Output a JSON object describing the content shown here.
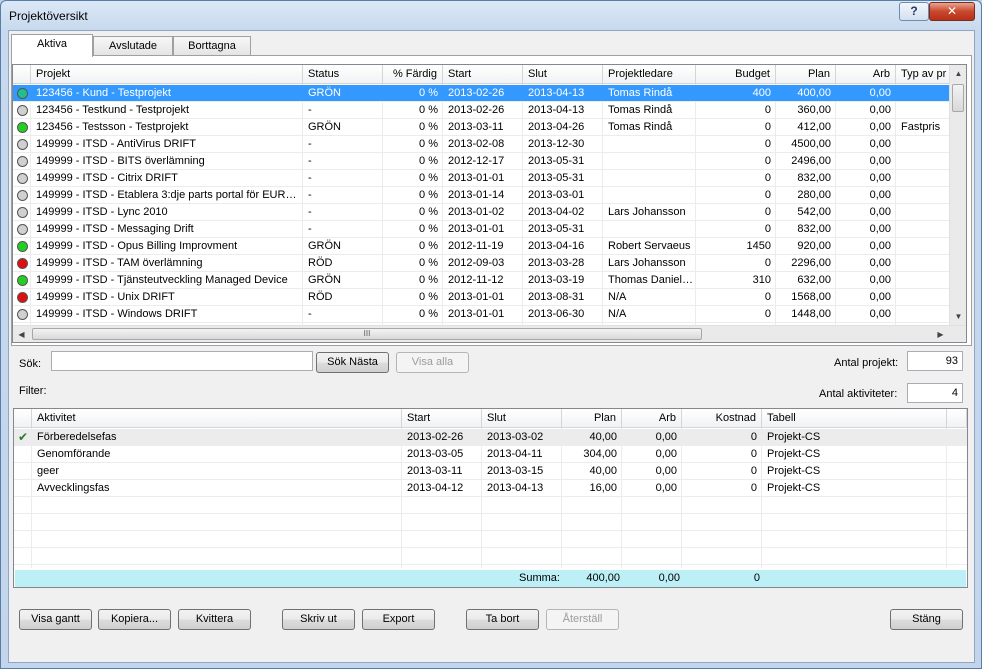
{
  "window": {
    "title": "Projektöversikt",
    "help_label": "?",
    "close_label": "✕"
  },
  "tabs": [
    {
      "label": "Aktiva",
      "active": true
    },
    {
      "label": "Avslutade",
      "active": false
    },
    {
      "label": "Borttagna",
      "active": false
    }
  ],
  "project_grid": {
    "headers": [
      "Projekt",
      "Status",
      "% Färdig",
      "Start",
      "Slut",
      "Projektledare",
      "Budget",
      "Plan",
      "Arb",
      "Typ av pr"
    ],
    "rows": [
      {
        "status_color": "#1fbf8f",
        "projekt": "123456 - Kund - Testprojekt",
        "status": "GRÖN",
        "pct": "0 %",
        "start": "2013-02-26",
        "slut": "2013-04-13",
        "ledare": "Tomas Rindå",
        "budget": "400",
        "plan": "400,00",
        "arb": "0,00",
        "typ": "",
        "selected": true
      },
      {
        "status_color": "#d0d0d0",
        "projekt": "123456 - Testkund - Testprojekt",
        "status": "-",
        "pct": "0 %",
        "start": "2013-02-26",
        "slut": "2013-04-13",
        "ledare": "Tomas Rindå",
        "budget": "0",
        "plan": "360,00",
        "arb": "0,00",
        "typ": ""
      },
      {
        "status_color": "#22d022",
        "projekt": "123456 - Testsson - Testprojekt",
        "status": "GRÖN",
        "pct": "0 %",
        "start": "2013-03-11",
        "slut": "2013-04-26",
        "ledare": "Tomas Rindå",
        "budget": "0",
        "plan": "412,00",
        "arb": "0,00",
        "typ": "Fastpris"
      },
      {
        "status_color": "#d0d0d0",
        "projekt": "149999 - ITSD - AntiVirus DRIFT",
        "status": "-",
        "pct": "0 %",
        "start": "2013-02-08",
        "slut": "2013-12-30",
        "ledare": "",
        "budget": "0",
        "plan": "4500,00",
        "arb": "0,00",
        "typ": ""
      },
      {
        "status_color": "#d0d0d0",
        "projekt": "149999 - ITSD - BITS överlämning",
        "status": "-",
        "pct": "0 %",
        "start": "2012-12-17",
        "slut": "2013-05-31",
        "ledare": "",
        "budget": "0",
        "plan": "2496,00",
        "arb": "0,00",
        "typ": ""
      },
      {
        "status_color": "#d0d0d0",
        "projekt": "149999 - ITSD - Citrix DRIFT",
        "status": "-",
        "pct": "0 %",
        "start": "2013-01-01",
        "slut": "2013-05-31",
        "ledare": "",
        "budget": "0",
        "plan": "832,00",
        "arb": "0,00",
        "typ": ""
      },
      {
        "status_color": "#d0d0d0",
        "projekt": "149999 - ITSD - Etablera 3:dje parts portal för EUR…",
        "status": "-",
        "pct": "0 %",
        "start": "2013-01-14",
        "slut": "2013-03-01",
        "ledare": "",
        "budget": "0",
        "plan": "280,00",
        "arb": "0,00",
        "typ": ""
      },
      {
        "status_color": "#d0d0d0",
        "projekt": "149999 - ITSD - Lync 2010",
        "status": "-",
        "pct": "0 %",
        "start": "2013-01-02",
        "slut": "2013-04-02",
        "ledare": "Lars Johansson",
        "budget": "0",
        "plan": "542,00",
        "arb": "0,00",
        "typ": ""
      },
      {
        "status_color": "#d0d0d0",
        "projekt": "149999 - ITSD - Messaging Drift",
        "status": "-",
        "pct": "0 %",
        "start": "2013-01-01",
        "slut": "2013-05-31",
        "ledare": "",
        "budget": "0",
        "plan": "832,00",
        "arb": "0,00",
        "typ": ""
      },
      {
        "status_color": "#22d022",
        "projekt": "149999 - ITSD - Opus Billing Improvment",
        "status": "GRÖN",
        "pct": "0 %",
        "start": "2012-11-19",
        "slut": "2013-04-16",
        "ledare": "Robert Servaeus",
        "budget": "1450",
        "plan": "920,00",
        "arb": "0,00",
        "typ": ""
      },
      {
        "status_color": "#e01010",
        "projekt": "149999 - ITSD - TAM överlämning",
        "status": "RÖD",
        "pct": "0 %",
        "start": "2012-09-03",
        "slut": "2013-03-28",
        "ledare": "Lars Johansson",
        "budget": "0",
        "plan": "2296,00",
        "arb": "0,00",
        "typ": ""
      },
      {
        "status_color": "#22d022",
        "projekt": "149999 - ITSD - Tjänsteutveckling Managed Device",
        "status": "GRÖN",
        "pct": "0 %",
        "start": "2012-11-12",
        "slut": "2013-03-19",
        "ledare": "Thomas Daniel…",
        "budget": "310",
        "plan": "632,00",
        "arb": "0,00",
        "typ": ""
      },
      {
        "status_color": "#e01010",
        "projekt": "149999 - ITSD - Unix DRIFT",
        "status": "RÖD",
        "pct": "0 %",
        "start": "2013-01-01",
        "slut": "2013-08-31",
        "ledare": "N/A",
        "budget": "0",
        "plan": "1568,00",
        "arb": "0,00",
        "typ": ""
      },
      {
        "status_color": "#d0d0d0",
        "projekt": "149999 - ITSD - Windows DRIFT",
        "status": "-",
        "pct": "0 %",
        "start": "2013-01-01",
        "slut": "2013-06-30",
        "ledare": "N/A",
        "budget": "0",
        "plan": "1448,00",
        "arb": "0,00",
        "typ": ""
      }
    ],
    "hscroll_grip": "III"
  },
  "search": {
    "label": "Sök:",
    "value": "",
    "next_label": "Sök Nästa",
    "show_all_label": "Visa alla",
    "count_label": "Antal projekt:",
    "count_value": "93"
  },
  "filter": {
    "label": "Filter:",
    "activity_count_label": "Antal aktiviteter:",
    "activity_count_value": "4"
  },
  "activity_grid": {
    "headers": [
      "Aktivitet",
      "Start",
      "Slut",
      "Plan",
      "Arb",
      "Kostnad",
      "Tabell"
    ],
    "rows": [
      {
        "done": true,
        "aktivitet": "Förberedelsefas",
        "start": "2013-02-26",
        "slut": "2013-03-02",
        "plan": "40,00",
        "arb": "0,00",
        "kostnad": "0",
        "tabell": "Projekt-CS"
      },
      {
        "done": false,
        "aktivitet": "Genomförande",
        "start": "2013-03-05",
        "slut": "2013-04-11",
        "plan": "304,00",
        "arb": "0,00",
        "kostnad": "0",
        "tabell": "Projekt-CS"
      },
      {
        "done": false,
        "aktivitet": "geer",
        "start": "2013-03-11",
        "slut": "2013-03-15",
        "plan": "40,00",
        "arb": "0,00",
        "kostnad": "0",
        "tabell": "Projekt-CS"
      },
      {
        "done": false,
        "aktivitet": "Avvecklingsfas",
        "start": "2013-04-12",
        "slut": "2013-04-13",
        "plan": "16,00",
        "arb": "0,00",
        "kostnad": "0",
        "tabell": "Projekt-CS"
      }
    ],
    "summary": {
      "label": "Summa:",
      "plan": "400,00",
      "arb": "0,00",
      "kostnad": "0"
    }
  },
  "buttons": {
    "gantt": "Visa gantt",
    "copy": "Kopiera...",
    "ack": "Kvittera",
    "print": "Skriv ut",
    "export": "Export",
    "delete": "Ta bort",
    "restore": "Återställ",
    "close": "Stäng"
  }
}
